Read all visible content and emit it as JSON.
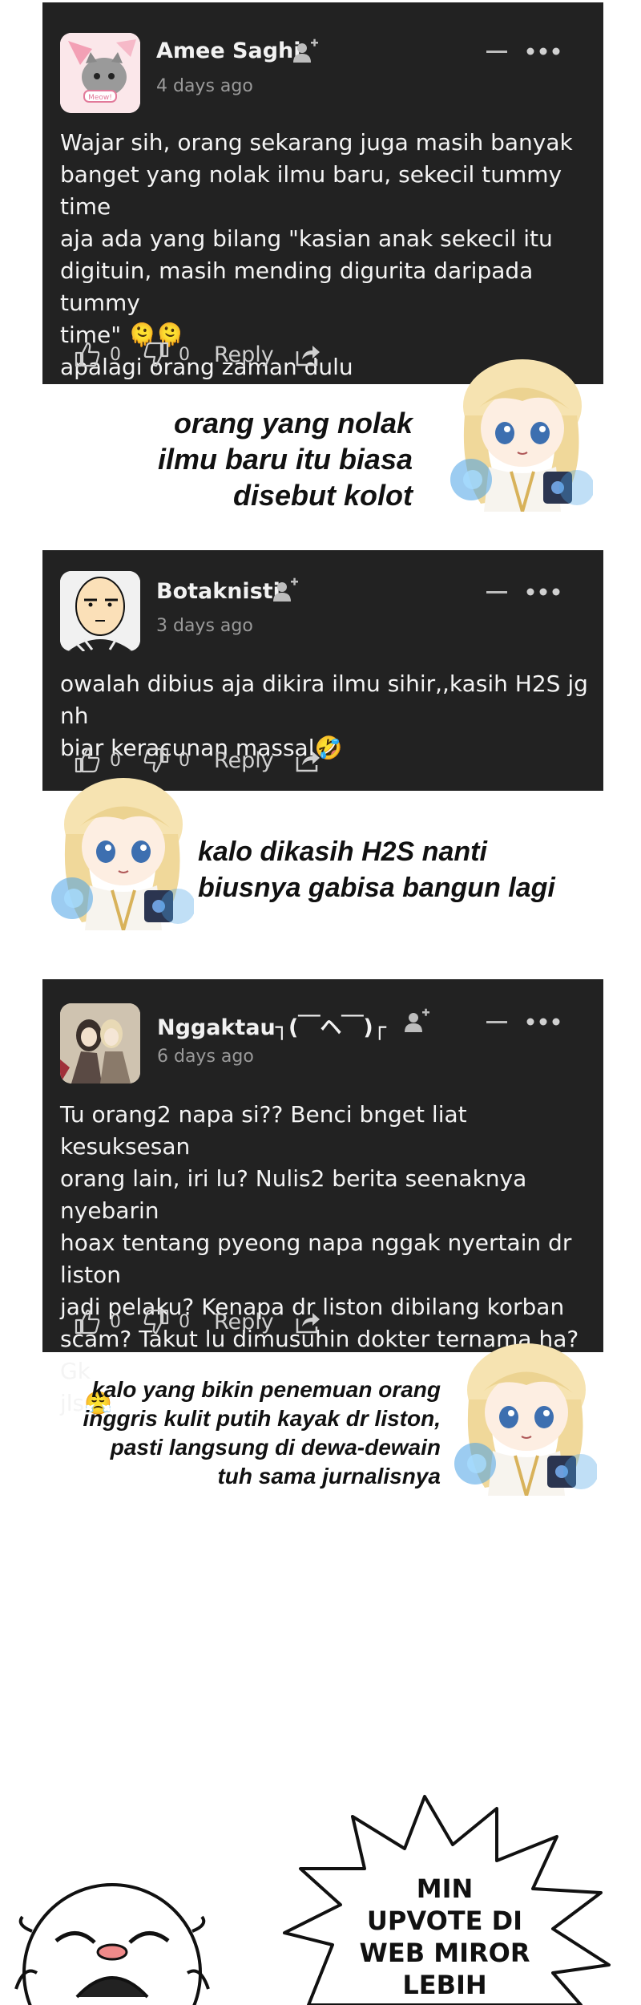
{
  "comments": [
    {
      "username": "Amee Saghi",
      "time": "4 days ago",
      "body": "Wajar sih, orang sekarang juga masih banyak\nbanget yang nolak ilmu baru, sekecil tummy time\naja ada yang bilang \"kasian anak sekecil itu\ndigituin, masih mending digurita daripada tummy\ntime\" 🫠🫠\napalagi orang zaman dulu",
      "likes": "0",
      "dislikes": "0",
      "reply_label": "Reply"
    },
    {
      "username": "Botaknisti",
      "time": "3 days ago",
      "body": "owalah dibius aja dikira ilmu sihir,,kasih H2S jg nh\nbiar keracunan massal🤣",
      "likes": "0",
      "dislikes": "0",
      "reply_label": "Reply"
    },
    {
      "username": "Nggaktau┐(￣ヘ￣)┌",
      "time": "6 days ago",
      "body": "Tu orang2 napa si?? Benci bnget liat kesuksesan\norang lain, iri lu? Nulis2 berita seenaknya nyebarin\nhoax tentang pyeong napa nggak nyertain dr liston\njadi pelaku? Kenapa dr liston dibilang korban\nscam? Takut lu dimusuhin dokter ternama ha? Gk\njls😤",
      "likes": "0",
      "dislikes": "0",
      "reply_label": "Reply"
    }
  ],
  "captions": [
    "orang yang nolak\nilmu baru itu biasa\ndisebut kolot",
    "kalo dikasih H2S nanti\nbiusnya gabisa bangun lagi",
    "kalo yang bikin penemuan orang\ninggris kulit putih kayak dr liston,\npasti langsung di dewa-dewain\ntuh sama jurnalisnya"
  ],
  "speech_bubble": "MIN\nUPVOTE DI\nWEB MIROR\nLEBIH",
  "icons": [
    "follow-icon",
    "more-icon",
    "minimize-icon",
    "thumbs-up-icon",
    "thumbs-down-icon",
    "share-icon"
  ],
  "colors": {
    "card_bg": "#222222",
    "text": "#f4f4f4",
    "muted": "#9a9a9a"
  }
}
